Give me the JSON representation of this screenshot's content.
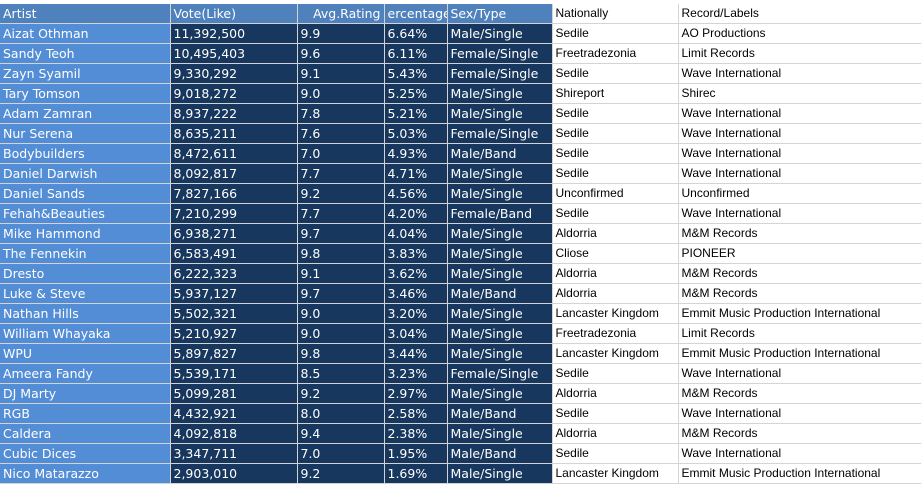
{
  "headers": [
    "Artist",
    "Vote(Like)",
    "Avg.Rating",
    "ercentage",
    "Sex/Type",
    "Nationally",
    "Record/Labels"
  ],
  "rows": [
    [
      "Aizat Othman",
      "11,392,500",
      "9.9",
      "6.64%",
      "Male/Single",
      "Sedile",
      "AO Productions"
    ],
    [
      "Sandy Teoh",
      "10,495,403",
      "9.6",
      "6.11%",
      "Female/Single",
      "Freetradezonia",
      "Limit Records"
    ],
    [
      "Zayn Syamil",
      "9,330,292",
      "9.1",
      "5.43%",
      "Female/Single",
      "Sedile",
      "Wave International"
    ],
    [
      "Tary Tomson",
      "9,018,272",
      "9.0",
      "5.25%",
      "Male/Single",
      "Shireport",
      "Shirec"
    ],
    [
      "Adam Zamran",
      "8,937,222",
      "7.8",
      "5.21%",
      "Male/Single",
      "Sedile",
      "Wave International"
    ],
    [
      "Nur Serena",
      "8,635,211",
      "7.6",
      "5.03%",
      "Female/Single",
      "Sedile",
      "Wave International"
    ],
    [
      "Bodybuilders",
      "8,472,611",
      "7.0",
      "4.93%",
      "Male/Band",
      "Sedile",
      "Wave International"
    ],
    [
      "Daniel Darwish",
      "8,092,817",
      "7.7",
      "4.71%",
      "Male/Single",
      "Sedile",
      "Wave International"
    ],
    [
      "Daniel Sands",
      "7,827,166",
      "9.2",
      "4.56%",
      "Male/Single",
      "Unconfirmed",
      "Unconfirmed"
    ],
    [
      "Fehah&Beauties",
      "7,210,299",
      "7.7",
      "4.20%",
      "Female/Band",
      "Sedile",
      "Wave International"
    ],
    [
      "Mike Hammond",
      "6,938,271",
      "9.7",
      "4.04%",
      "Male/Single",
      "Aldorria",
      "M&M Records"
    ],
    [
      "The Fennekin",
      "6,583,491",
      "9.8",
      "3.83%",
      "Male/Single",
      "Cliose",
      "PIONEER"
    ],
    [
      "Dresto",
      "6,222,323",
      "9.1",
      "3.62%",
      "Male/Single",
      "Aldorria",
      "M&M Records"
    ],
    [
      "Luke & Steve",
      "5,937,127",
      "9.7",
      "3.46%",
      "Male/Band",
      "Aldorria",
      "M&M Records"
    ],
    [
      "Nathan Hills",
      "5,502,321",
      "9.0",
      "3.20%",
      "Male/Single",
      "Lancaster Kingdom",
      "Emmit Music Production International"
    ],
    [
      "William Whayaka",
      "5,210,927",
      "9.0",
      "3.04%",
      "Male/Single",
      "Freetradezonia",
      "Limit Records"
    ],
    [
      "WPU",
      "5,897,827",
      "9.8",
      "3.44%",
      "Male/Single",
      "Lancaster Kingdom",
      "Emmit Music Production International"
    ],
    [
      "Ameera Fandy",
      "5,539,171",
      "8.5",
      "3.23%",
      "Female/Single",
      "Sedile",
      "Wave International"
    ],
    [
      "DJ Marty",
      "5,099,281",
      "9.2",
      "2.97%",
      "Male/Single",
      "Aldorria",
      "M&M Records"
    ],
    [
      "RGB",
      "4,432,921",
      "8.0",
      "2.58%",
      "Male/Band",
      "Sedile",
      "Wave International"
    ],
    [
      "Caldera",
      "4,092,818",
      "9.4",
      "2.38%",
      "Male/Single",
      "Aldorria",
      "M&M Records"
    ],
    [
      "Cubic Dices",
      "3,347,711",
      "7.0",
      "1.95%",
      "Male/Band",
      "Sedile",
      "Wave International"
    ],
    [
      "Nico Matarazzo",
      "2,903,010",
      "9.2",
      "1.69%",
      "Male/Single",
      "Lancaster Kingdom",
      "Emmit Music Production International"
    ]
  ],
  "colors": {
    "header_blue": "#4f81bd",
    "artist_blue": "#538dd5",
    "data_navy": "#17375e"
  }
}
